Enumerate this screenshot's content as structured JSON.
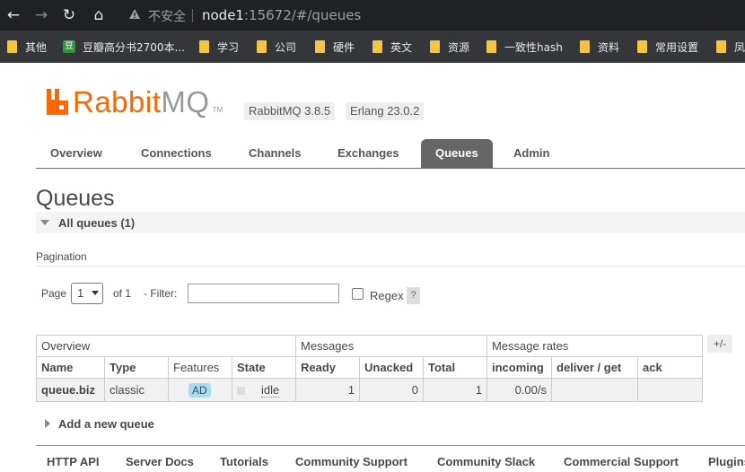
{
  "browser": {
    "insecure_label": "不安全",
    "url_host": "node1",
    "url_rest": ":15672/#/queues",
    "bookmarks": [
      {
        "label": "其他",
        "icon": "folder-icon"
      },
      {
        "label": "豆瓣高分书2700本...",
        "icon": "douban-icon",
        "icon_text": "豆"
      },
      {
        "label": "学习",
        "icon": "folder-icon"
      },
      {
        "label": "公司",
        "icon": "folder-icon"
      },
      {
        "label": "硬件",
        "icon": "folder-icon"
      },
      {
        "label": "英文",
        "icon": "folder-icon"
      },
      {
        "label": "资源",
        "icon": "folder-icon"
      },
      {
        "label": "一致性hash",
        "icon": "folder-icon"
      },
      {
        "label": "资料",
        "icon": "folder-icon"
      },
      {
        "label": "常用设置",
        "icon": "folder-icon"
      },
      {
        "label": "凤",
        "icon": "folder-icon"
      }
    ]
  },
  "header": {
    "logo_rabbit": "Rabbit",
    "logo_mq": "MQ",
    "logo_tm": "TM",
    "rabbitmq_version": "RabbitMQ 3.8.5",
    "erlang_version": "Erlang 23.0.2"
  },
  "tabs": [
    "Overview",
    "Connections",
    "Channels",
    "Exchanges",
    "Queues",
    "Admin"
  ],
  "active_tab": "Queues",
  "page": {
    "title": "Queues",
    "section_label": "All queues (1)",
    "pagination_label": "Pagination",
    "page_label": "Page",
    "page_value": "1",
    "of_label": "of 1",
    "filter_label": "- Filter:",
    "filter_value": "",
    "regex_label": "Regex",
    "help_label": "?",
    "regex_checked": false
  },
  "table": {
    "groups": [
      "Overview",
      "Messages",
      "Message rates"
    ],
    "columns": [
      "Name",
      "Type",
      "Features",
      "State",
      "Ready",
      "Unacked",
      "Total",
      "incoming",
      "deliver / get",
      "ack"
    ],
    "row": {
      "name": "queue.biz",
      "type": "classic",
      "features": "AD",
      "state": "idle",
      "ready": "1",
      "unacked": "0",
      "total": "1",
      "incoming": "0.00/s",
      "deliver_get": "",
      "ack": ""
    },
    "plus_minus": "+/-"
  },
  "add_queue_label": "Add a new queue",
  "footer": [
    "HTTP API",
    "Server Docs",
    "Tutorials",
    "Community Support",
    "Community Slack",
    "Commercial Support",
    "Plugins"
  ],
  "colors": {
    "brand_orange": "#ff6600",
    "feature_badge": "#aadcf0",
    "active_tab": "#666666"
  }
}
